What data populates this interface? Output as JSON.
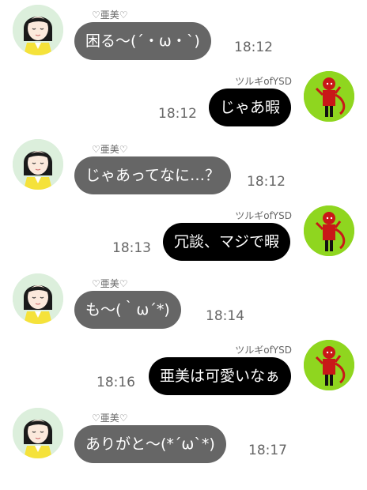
{
  "messages": [
    {
      "side": "left",
      "name": "♡亜美♡",
      "text": "困る〜(´・ω・`)",
      "time": "18:12"
    },
    {
      "side": "right",
      "name": "ツルギofYSD",
      "text": "じゃあ暇",
      "time": "18:12"
    },
    {
      "side": "left",
      "name": "♡亜美♡",
      "text": "じゃあってなに…？",
      "time": "18:12"
    },
    {
      "side": "right",
      "name": "ツルギofYSD",
      "text": "冗談、マジで暇",
      "time": "18:13"
    },
    {
      "side": "left",
      "name": "♡亜美♡",
      "text": "も〜(｀ω´*)",
      "time": "18:14"
    },
    {
      "side": "right",
      "name": "ツルギofYSD",
      "text": "亜美は可愛いなぁ",
      "time": "18:16"
    },
    {
      "side": "left",
      "name": "♡亜美♡",
      "text": "ありがと〜(*´ω`*)",
      "time": "18:17"
    }
  ],
  "icons": {
    "left_avatar": "girl-avatar-icon",
    "right_avatar": "red-devil-avatar-icon"
  },
  "colors": {
    "left_bubble": "#666666",
    "right_bubble": "#000000",
    "right_avatar_bg": "#8fd61f",
    "left_avatar_bg": "#dcefdc"
  }
}
